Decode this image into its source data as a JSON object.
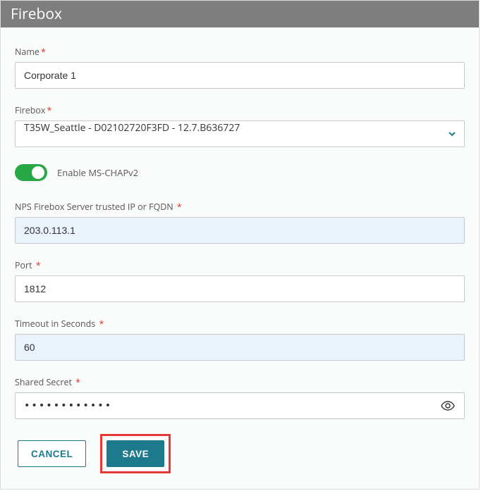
{
  "header": {
    "title": "Firebox"
  },
  "form": {
    "name": {
      "label": "Name",
      "required": true,
      "value": "Corporate 1"
    },
    "firebox": {
      "label": "Firebox",
      "required": true,
      "selected": "T35W_Seattle - D02102720F3FD - 12.7.B636727"
    },
    "mschap": {
      "label": "Enable MS-CHAPv2",
      "enabled": true
    },
    "ip": {
      "label": "NPS Firebox Server trusted IP or FQDN",
      "required": true,
      "value": "203.0.113.1"
    },
    "port": {
      "label": "Port",
      "required": true,
      "value": "1812"
    },
    "timeout": {
      "label": "Timeout in Seconds",
      "required": true,
      "value": "60"
    },
    "secret": {
      "label": "Shared Secret",
      "required": true,
      "masked": "••••••••••••"
    }
  },
  "buttons": {
    "cancel": "CANCEL",
    "save": "SAVE"
  },
  "colors": {
    "accent": "#1c7a8c",
    "toggleOn": "#28a745",
    "highlight": "#e53935"
  }
}
